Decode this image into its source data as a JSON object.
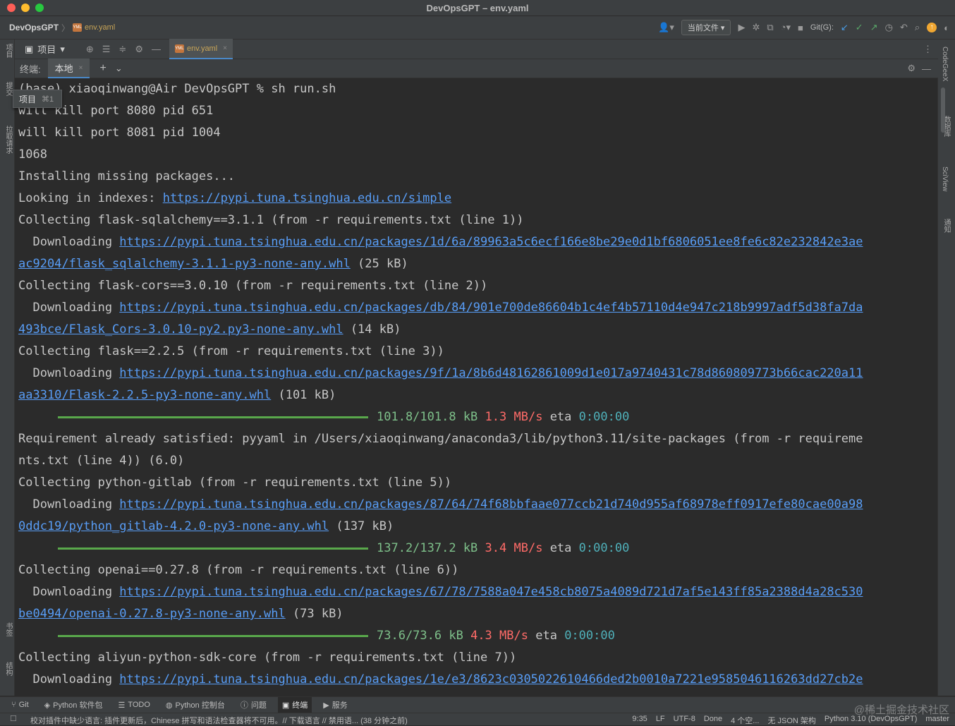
{
  "window": {
    "title": "DevOpsGPT – env.yaml"
  },
  "navbar": {
    "project": "DevOpsGPT",
    "file_badge": "YML",
    "file": "env.yaml",
    "run_config": "当前文件",
    "git_label": "Git(G):"
  },
  "left_strip": {
    "project_tab": "项目",
    "commit_tab": "提交",
    "pr_tab": "拉取请求",
    "bookmarks_tab": "书签",
    "structure_tab": "结构"
  },
  "right_strip": {
    "codegeex": "CodeGeeX",
    "database": "数据库",
    "sciview": "SciView",
    "notifications": "通知"
  },
  "toolwindow": {
    "project_label": "项目",
    "editor_tab": "env.yaml",
    "editor_tab_close": "×"
  },
  "terminal_bar": {
    "label": "终端:",
    "tab": "本地",
    "tab_close": "×",
    "add": "+",
    "more": "⌄"
  },
  "tooltip": {
    "label": "项目",
    "shortcut": "⌘1"
  },
  "terminal": {
    "lines": [
      {
        "type": "text",
        "text": "(base) xiaoqinwang@Air DevOpsGPT % sh run.sh"
      },
      {
        "type": "text",
        "text": "will kill port 8080 pid 651"
      },
      {
        "type": "text",
        "text": "will kill port 8081 pid 1004"
      },
      {
        "type": "text",
        "text": "1068"
      },
      {
        "type": "text",
        "text": "Installing missing packages..."
      },
      {
        "type": "link",
        "pre": "Looking in indexes: ",
        "link": "https://pypi.tuna.tsinghua.edu.cn/simple",
        "post": ""
      },
      {
        "type": "text",
        "text": "Collecting flask-sqlalchemy==3.1.1 (from -r requirements.txt (line 1))"
      },
      {
        "type": "link",
        "pre": "  Downloading ",
        "link": "https://pypi.tuna.tsinghua.edu.cn/packages/1d/6a/89963a5c6ecf166e8be29e0d1bf6806051ee8fe6c82e232842e3ae",
        "post": ""
      },
      {
        "type": "link",
        "pre": "",
        "link": "ac9204/flask_sqlalchemy-3.1.1-py3-none-any.whl",
        "post": " (25 kB)"
      },
      {
        "type": "text",
        "text": "Collecting flask-cors==3.0.10 (from -r requirements.txt (line 2))"
      },
      {
        "type": "link",
        "pre": "  Downloading ",
        "link": "https://pypi.tuna.tsinghua.edu.cn/packages/db/84/901e700de86604b1c4ef4b57110d4e947c218b9997adf5d38fa7da",
        "post": ""
      },
      {
        "type": "link",
        "pre": "",
        "link": "493bce/Flask_Cors-3.0.10-py2.py3-none-any.whl",
        "post": " (14 kB)"
      },
      {
        "type": "text",
        "text": "Collecting flask==2.2.5 (from -r requirements.txt (line 3))"
      },
      {
        "type": "link",
        "pre": "  Downloading ",
        "link": "https://pypi.tuna.tsinghua.edu.cn/packages/9f/1a/8b6d48162861009d1e017a9740431c78d860809773b66cac220a11",
        "post": ""
      },
      {
        "type": "link",
        "pre": "",
        "link": "aa3310/Flask-2.2.5-py3-none-any.whl",
        "post": " (101 kB)"
      },
      {
        "type": "progress",
        "num": "101.8/101.8 kB",
        "speed": "1.3 MB/s",
        "eta": "eta",
        "time": "0:00:00"
      },
      {
        "type": "text",
        "text": "Requirement already satisfied: pyyaml in /Users/xiaoqinwang/anaconda3/lib/python3.11/site-packages (from -r requireme"
      },
      {
        "type": "text",
        "text": "nts.txt (line 4)) (6.0)"
      },
      {
        "type": "text",
        "text": "Collecting python-gitlab (from -r requirements.txt (line 5))"
      },
      {
        "type": "link",
        "pre": "  Downloading ",
        "link": "https://pypi.tuna.tsinghua.edu.cn/packages/87/64/74f68bbfaae077ccb21d740d955af68978eff0917efe80cae00a98",
        "post": ""
      },
      {
        "type": "link",
        "pre": "",
        "link": "0ddc19/python_gitlab-4.2.0-py3-none-any.whl",
        "post": " (137 kB)"
      },
      {
        "type": "progress",
        "num": "137.2/137.2 kB",
        "speed": "3.4 MB/s",
        "eta": "eta",
        "time": "0:00:00"
      },
      {
        "type": "text",
        "text": "Collecting openai==0.27.8 (from -r requirements.txt (line 6))"
      },
      {
        "type": "link",
        "pre": "  Downloading ",
        "link": "https://pypi.tuna.tsinghua.edu.cn/packages/67/78/7588a047e458cb8075a4089d721d7af5e143ff85a2388d4a28c530",
        "post": ""
      },
      {
        "type": "link",
        "pre": "",
        "link": "be0494/openai-0.27.8-py3-none-any.whl",
        "post": " (73 kB)"
      },
      {
        "type": "progress",
        "num": "73.6/73.6 kB",
        "speed": "4.3 MB/s",
        "eta": "eta",
        "time": "0:00:00"
      },
      {
        "type": "text",
        "text": "Collecting aliyun-python-sdk-core (from -r requirements.txt (line 7))"
      },
      {
        "type": "link",
        "pre": "  Downloading ",
        "link": "https://pypi.tuna.tsinghua.edu.cn/packages/1e/e3/8623c0305022610466ded2b0010a7221e9585046116263dd27cb2e",
        "post": ""
      }
    ]
  },
  "bottom_tools": [
    {
      "name": "git",
      "icon": "branch-icon",
      "label": "Git",
      "active": false
    },
    {
      "name": "python-packages",
      "icon": "package-icon",
      "label": "Python 软件包",
      "active": false
    },
    {
      "name": "todo",
      "icon": "list-icon",
      "label": "TODO",
      "active": false
    },
    {
      "name": "python-console",
      "icon": "console-icon",
      "label": "Python 控制台",
      "active": false
    },
    {
      "name": "problems",
      "icon": "info-icon",
      "label": "问题",
      "active": false
    },
    {
      "name": "terminal",
      "icon": "terminal-icon",
      "label": "终端",
      "active": true
    },
    {
      "name": "services",
      "icon": "play-icon",
      "label": "服务",
      "active": false
    }
  ],
  "status": {
    "message": "校对插件中缺少语言: 插件更新后，Chinese 拼写和语法检查器将不可用。// 下载语言 // 禁用语... (38 分钟之前)",
    "position": "9:35",
    "line_sep": "LF",
    "encoding": "UTF-8",
    "done": "Done",
    "indent": "4 个空...",
    "schema": "无 JSON 架构",
    "interpreter": "Python 3.10 (DevOpsGPT)",
    "branch": "master"
  },
  "watermark": "@稀土掘金技术社区",
  "colors": {
    "link": "#589df6",
    "progress": "#59a84b",
    "speed": "#ff6b68",
    "accent": "#4a88c7"
  }
}
